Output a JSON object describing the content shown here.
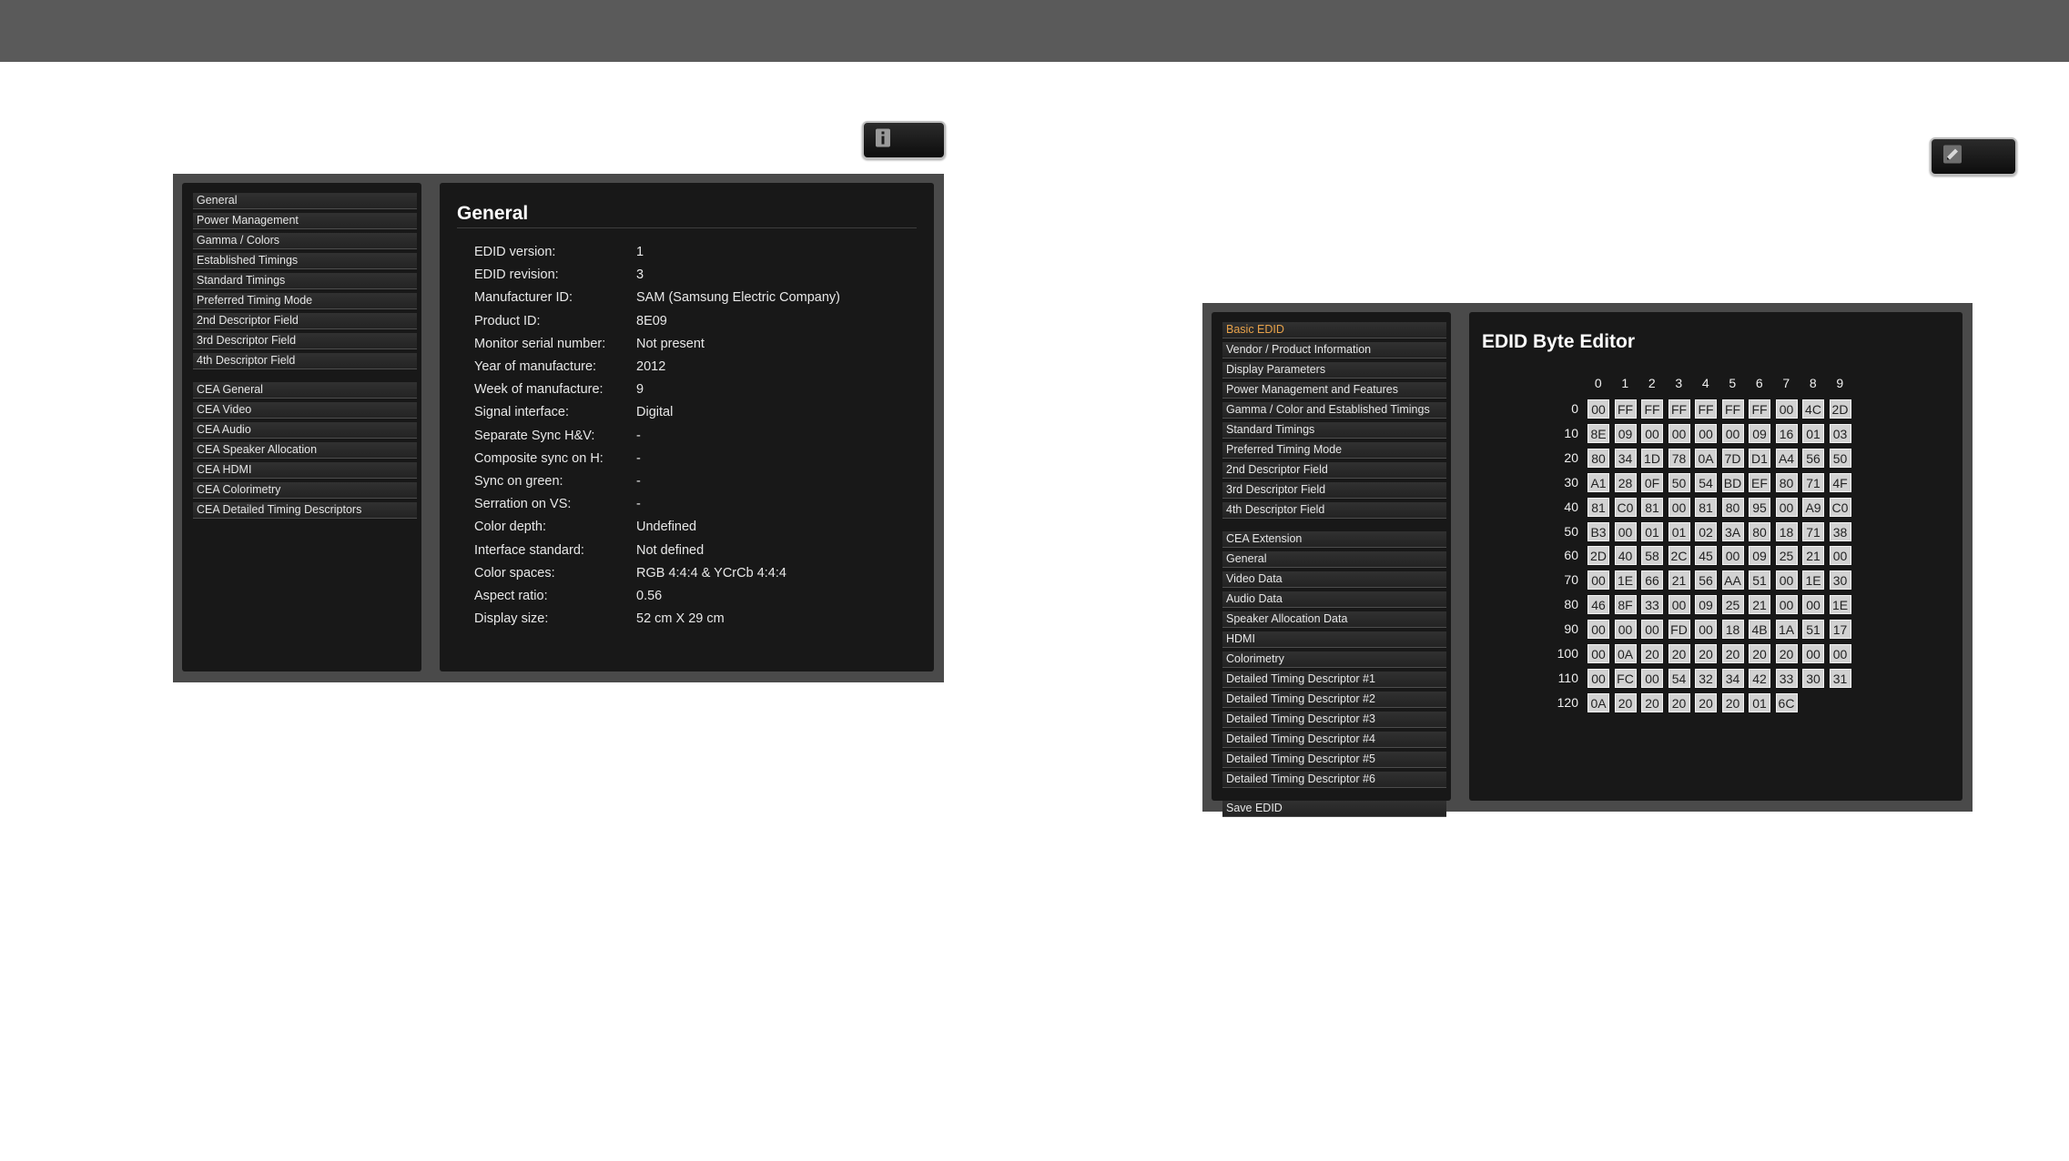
{
  "left_panel": {
    "menu_group1": [
      "General",
      "Power Management",
      "Gamma / Colors",
      "Established Timings",
      "Standard Timings",
      "Preferred Timing Mode",
      "2nd Descriptor Field",
      "3rd Descriptor Field",
      "4th Descriptor Field"
    ],
    "menu_group2": [
      "CEA General",
      "CEA Video",
      "CEA Audio",
      "CEA Speaker Allocation",
      "CEA HDMI",
      "CEA Colorimetry",
      "CEA Detailed Timing Descriptors"
    ],
    "title": "General",
    "info": [
      {
        "key": "EDID version:",
        "value": "1"
      },
      {
        "key": "EDID revision:",
        "value": "3"
      },
      {
        "key": "Manufacturer ID:",
        "value": "SAM (Samsung Electric Company)"
      },
      {
        "key": "Product ID:",
        "value": "8E09"
      },
      {
        "key": "Monitor serial number:",
        "value": "Not present"
      },
      {
        "key": "Year of manufacture:",
        "value": "2012"
      },
      {
        "key": "Week of manufacture:",
        "value": "9"
      },
      {
        "key": "Signal interface:",
        "value": "Digital"
      },
      {
        "key": "Separate Sync H&V:",
        "value": "-"
      },
      {
        "key": "Composite sync on H:",
        "value": "-"
      },
      {
        "key": "Sync on green:",
        "value": "-"
      },
      {
        "key": "Serration on VS:",
        "value": "-"
      },
      {
        "key": "Color depth:",
        "value": "Undefined"
      },
      {
        "key": "Interface standard:",
        "value": "Not defined"
      },
      {
        "key": "Color spaces:",
        "value": "RGB 4:4:4 & YCrCb 4:4:4"
      },
      {
        "key": "Aspect ratio:",
        "value": "0.56"
      },
      {
        "key": "Display size:",
        "value": "52 cm X 29 cm"
      }
    ],
    "button_icon": "info-icon"
  },
  "right_panel": {
    "menu_group1": [
      "Basic EDID",
      "Vendor / Product Information",
      "Display Parameters",
      "Power Management and Features",
      "Gamma / Color and Established Timings",
      "Standard Timings",
      "Preferred Timing Mode",
      "2nd Descriptor Field",
      "3rd Descriptor Field",
      "4th Descriptor Field"
    ],
    "menu_group2": [
      "CEA Extension",
      "General",
      "Video Data",
      "Audio Data",
      "Speaker Allocation Data",
      "HDMI",
      "Colorimetry",
      "Detailed Timing Descriptor #1",
      "Detailed Timing Descriptor #2",
      "Detailed Timing Descriptor #3",
      "Detailed Timing Descriptor #4",
      "Detailed Timing Descriptor #5",
      "Detailed Timing Descriptor #6"
    ],
    "menu_group3": [
      "Save EDID"
    ],
    "active_item": "Basic EDID",
    "title": "EDID Byte Editor",
    "button_icon": "pencil-icon",
    "hex": {
      "col_headers": [
        "0",
        "1",
        "2",
        "3",
        "4",
        "5",
        "6",
        "7",
        "8",
        "9"
      ],
      "row_labels": [
        "0",
        "10",
        "20",
        "30",
        "40",
        "50",
        "60",
        "70",
        "80",
        "90",
        "100",
        "110",
        "120"
      ],
      "rows": [
        [
          "00",
          "FF",
          "FF",
          "FF",
          "FF",
          "FF",
          "FF",
          "00",
          "4C",
          "2D"
        ],
        [
          "8E",
          "09",
          "00",
          "00",
          "00",
          "00",
          "09",
          "16",
          "01",
          "03"
        ],
        [
          "80",
          "34",
          "1D",
          "78",
          "0A",
          "7D",
          "D1",
          "A4",
          "56",
          "50"
        ],
        [
          "A1",
          "28",
          "0F",
          "50",
          "54",
          "BD",
          "EF",
          "80",
          "71",
          "4F"
        ],
        [
          "81",
          "C0",
          "81",
          "00",
          "81",
          "80",
          "95",
          "00",
          "A9",
          "C0"
        ],
        [
          "B3",
          "00",
          "01",
          "01",
          "02",
          "3A",
          "80",
          "18",
          "71",
          "38"
        ],
        [
          "2D",
          "40",
          "58",
          "2C",
          "45",
          "00",
          "09",
          "25",
          "21",
          "00"
        ],
        [
          "00",
          "1E",
          "66",
          "21",
          "56",
          "AA",
          "51",
          "00",
          "1E",
          "30"
        ],
        [
          "46",
          "8F",
          "33",
          "00",
          "09",
          "25",
          "21",
          "00",
          "00",
          "1E"
        ],
        [
          "00",
          "00",
          "00",
          "FD",
          "00",
          "18",
          "4B",
          "1A",
          "51",
          "17"
        ],
        [
          "00",
          "0A",
          "20",
          "20",
          "20",
          "20",
          "20",
          "20",
          "00",
          "00"
        ],
        [
          "00",
          "FC",
          "00",
          "54",
          "32",
          "34",
          "42",
          "33",
          "30",
          "31"
        ],
        [
          "0A",
          "20",
          "20",
          "20",
          "20",
          "20",
          "01",
          "6C"
        ]
      ]
    }
  },
  "colors": {
    "active_menu": "#e8a24a",
    "topbar": "#5a5a5a",
    "panel_bg": "#181818"
  }
}
